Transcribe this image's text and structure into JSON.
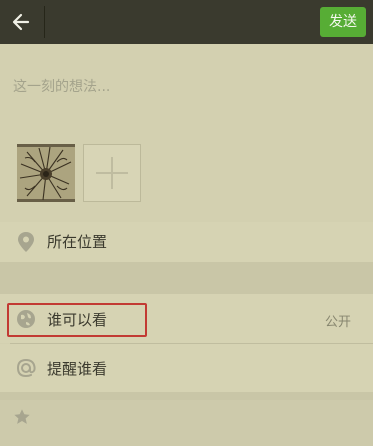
{
  "header": {
    "back_icon": "arrow-left-icon",
    "send_label": "发送",
    "colors": {
      "bar": "#3a3a2e",
      "send": "#57ad35",
      "highlight": "#c23a33"
    }
  },
  "composer": {
    "placeholder": "这一刻的想法..."
  },
  "photos": {
    "thumbnail_icon": "photo-thumbnail",
    "add_icon": "plus-icon"
  },
  "rows": {
    "location": {
      "label": "所在位置",
      "icon": "map-pin-icon"
    },
    "visibility": {
      "label": "谁可以看",
      "value": "公开",
      "icon": "globe-icon",
      "highlighted": true
    },
    "remind": {
      "label": "提醒谁看",
      "icon": "at-sign-icon"
    },
    "favorite": {
      "icon": "star-icon"
    }
  }
}
